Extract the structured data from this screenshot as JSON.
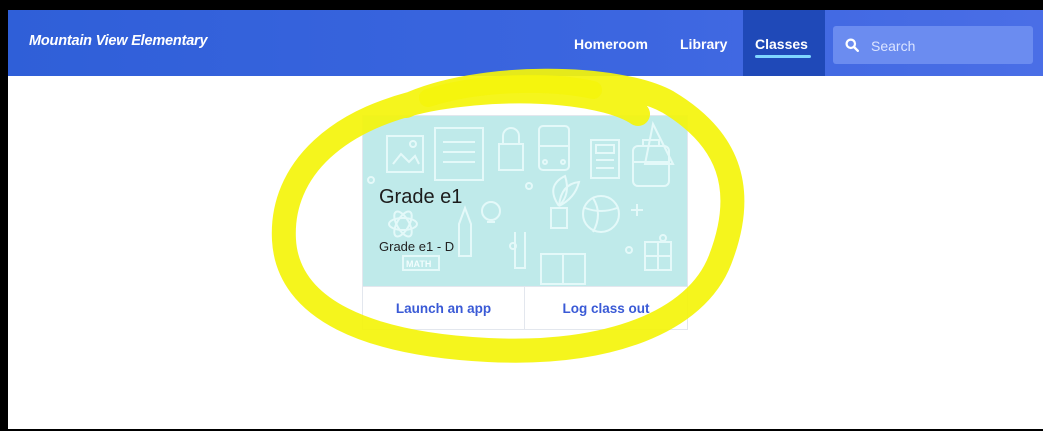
{
  "header": {
    "brand": "Mountain View Elementary",
    "nav": {
      "homeroom": "Homeroom",
      "library": "Library",
      "classes": "Classes"
    },
    "search": {
      "placeholder": "Search",
      "icon": "search-icon"
    }
  },
  "class_card": {
    "title": "Grade e1",
    "subtitle": "Grade e1 - D",
    "art_label": "MATH",
    "actions": {
      "launch": "Launch an app",
      "logout": "Log class out"
    }
  },
  "colors": {
    "nav_bg": "#3c66e0",
    "active_tab_bg": "#1f49b8",
    "active_underline": "#7fd6ff",
    "card_art_bg": "#bfeaea",
    "action_text": "#3a5ad6",
    "highlight_marker": "#f4f40a"
  }
}
